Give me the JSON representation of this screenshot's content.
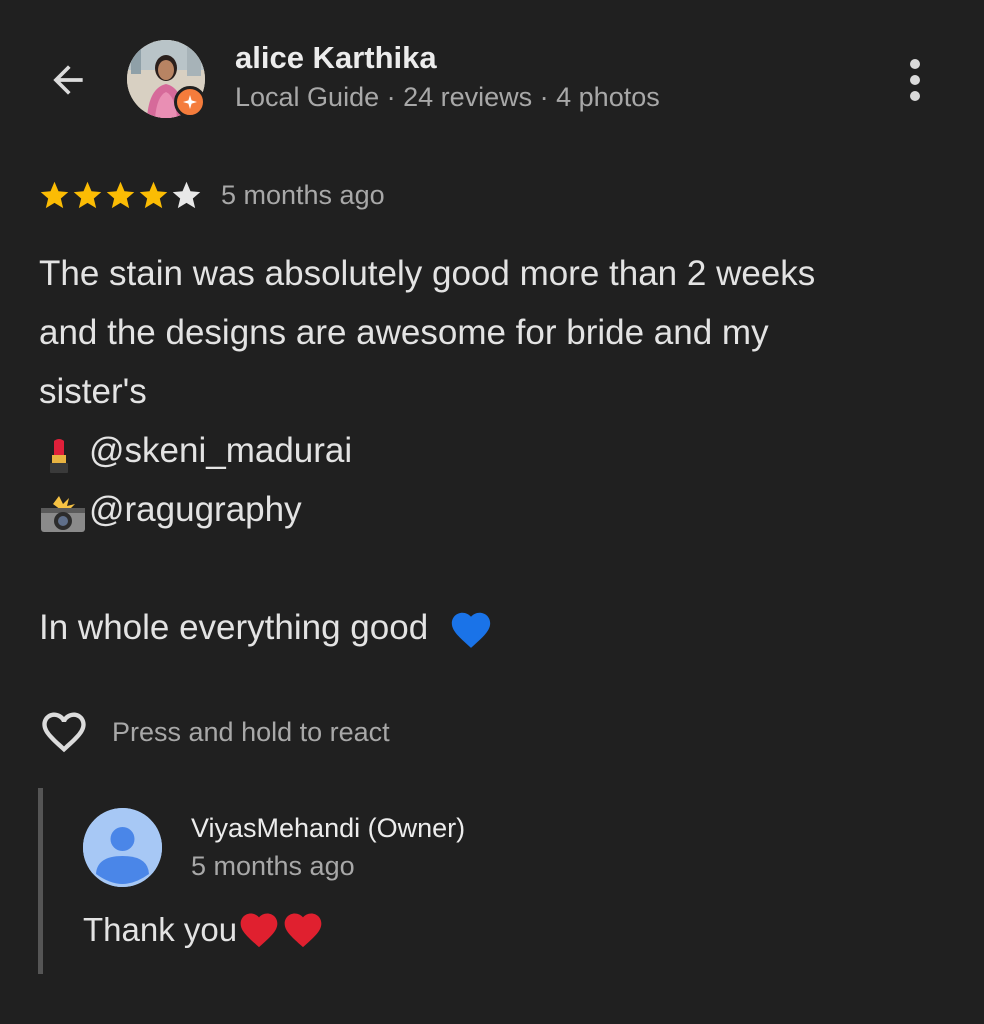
{
  "header": {
    "back_icon": "arrow-left-icon",
    "reviewer_name": "alice Karthika",
    "reviewer_meta": "Local Guide · 24 reviews · 4 photos",
    "more_icon": "more-vert-icon",
    "badge_color": "#f47c3c"
  },
  "review": {
    "rating": 4,
    "rating_max": 5,
    "star_color": "#fbbc04",
    "time": "5 months ago",
    "text_lines": [
      "The stain was absolutely good more than 2 weeks",
      "and the designs are awesome for bride and my",
      "sister's"
    ],
    "mention_1": "@skeni_madurai",
    "mention_1_icon": "lipstick-icon",
    "mention_2": "@ragugraphy",
    "mention_2_icon": "camera-flash-icon",
    "closing": "In whole everything good",
    "closing_icon": "blue-heart-icon"
  },
  "reactions": {
    "icon": "heart-outline-icon",
    "label": "Press and hold to react"
  },
  "owner_reply": {
    "name": "ViyasMehandi (Owner)",
    "time": "5 months ago",
    "text": "Thank you",
    "reply_icons": [
      "red-heart-icon",
      "red-heart-icon"
    ],
    "avatar_color": "#a7c8f5"
  }
}
